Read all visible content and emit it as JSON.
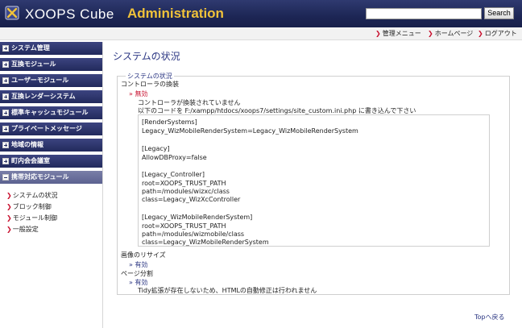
{
  "header": {
    "logo_text": "XOOPS Cube",
    "logo_admin": "Administration",
    "search_button": "Search",
    "search_value": ""
  },
  "topnav": [
    {
      "label": "管理メニュー"
    },
    {
      "label": "ホームページ"
    },
    {
      "label": "ログアウト"
    }
  ],
  "sidebar": {
    "menus": [
      {
        "label": "システム管理"
      },
      {
        "label": "互換モジュール"
      },
      {
        "label": "ユーザーモジュール"
      },
      {
        "label": "互換レンダーシステム"
      },
      {
        "label": "標準キャッシュモジュール"
      },
      {
        "label": "プライベートメッセージ"
      },
      {
        "label": "地域の情報"
      },
      {
        "label": "町内会会議室"
      },
      {
        "label": "携帯対応モジュール"
      }
    ],
    "submenu": [
      {
        "label": "システムの状況"
      },
      {
        "label": "ブロック制御"
      },
      {
        "label": "モジュール制御"
      },
      {
        "label": "一般設定"
      }
    ]
  },
  "main": {
    "title": "システムの状況",
    "legend": "システムの状況",
    "controller_heading": "コントローラの換装",
    "controller_status": "無効",
    "controller_msg1": "コントローラが換装されていません",
    "controller_msg2": "以下のコードを F:/xampp/htdocs/xoops7/settings/site_custom.ini.php に書き込んで下さい",
    "code_lines": [
      "[RenderSystems]",
      "Legacy_WizMobileRenderSystem=Legacy_WizMobileRenderSystem",
      "",
      "[Legacy]",
      "AllowDBProxy=false",
      "",
      "[Legacy_Controller]",
      "root=XOOPS_TRUST_PATH",
      "path=/modules/wizxc/class",
      "class=Legacy_WizXcController",
      "",
      "[Legacy_WizMobileRenderSystem]",
      "root=XOOPS_TRUST_PATH",
      "path=/modules/wizmobile/class",
      "class=Legacy_WizMobileRenderSystem"
    ],
    "resize_heading": "画像のリサイズ",
    "resize_status": "有効",
    "split_heading": "ページ分割",
    "split_status": "有効",
    "split_msg": "Tidy拡張が存在しないため、HTMLの自動修正は行われません",
    "top_link": "Topへ戻る"
  },
  "colors": {
    "header_bg": "#1d2655",
    "accent_gold": "#f0c23a",
    "menu_bg": "#222a5c",
    "status_red": "#c8102e",
    "link_blue": "#2a3582"
  }
}
